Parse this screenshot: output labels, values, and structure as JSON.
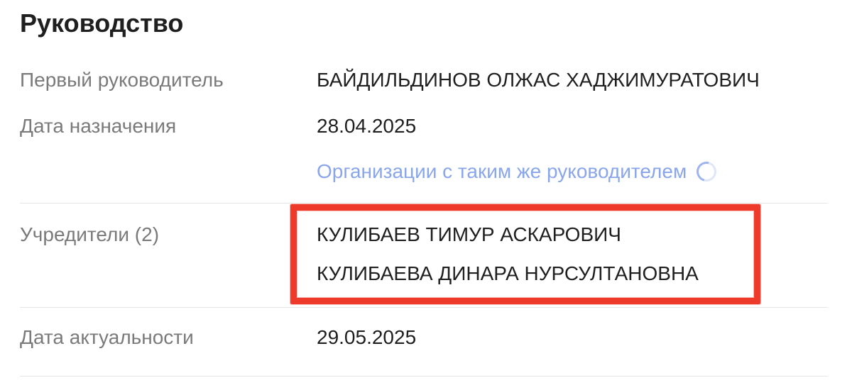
{
  "section": {
    "title": "Руководство"
  },
  "rows": {
    "head": {
      "label": "Первый руководитель",
      "value": "БАЙДИЛЬДИНОВ ОЛЖАС ХАДЖИМУРАТОВИЧ"
    },
    "appointment": {
      "label": "Дата назначения",
      "value": "28.04.2025"
    },
    "same_head_link": {
      "label": "Организации с таким же руководителем",
      "icon": "loading-spinner-icon"
    },
    "founders": {
      "label": "Учредители (2)",
      "items": [
        "КУЛИБАЕВ ТИМУР АСКАРОВИЧ",
        "КУЛИБАЕВА ДИНАРА НУРСУЛТАНОВНА"
      ]
    },
    "actuality": {
      "label": "Дата актуальности",
      "value": "29.05.2025"
    }
  },
  "colors": {
    "label": "#7a7a7a",
    "value": "#1f1f1f",
    "link": "#8aa6ea",
    "highlight": "#ee3a2b",
    "divider": "#e6e6e6"
  }
}
